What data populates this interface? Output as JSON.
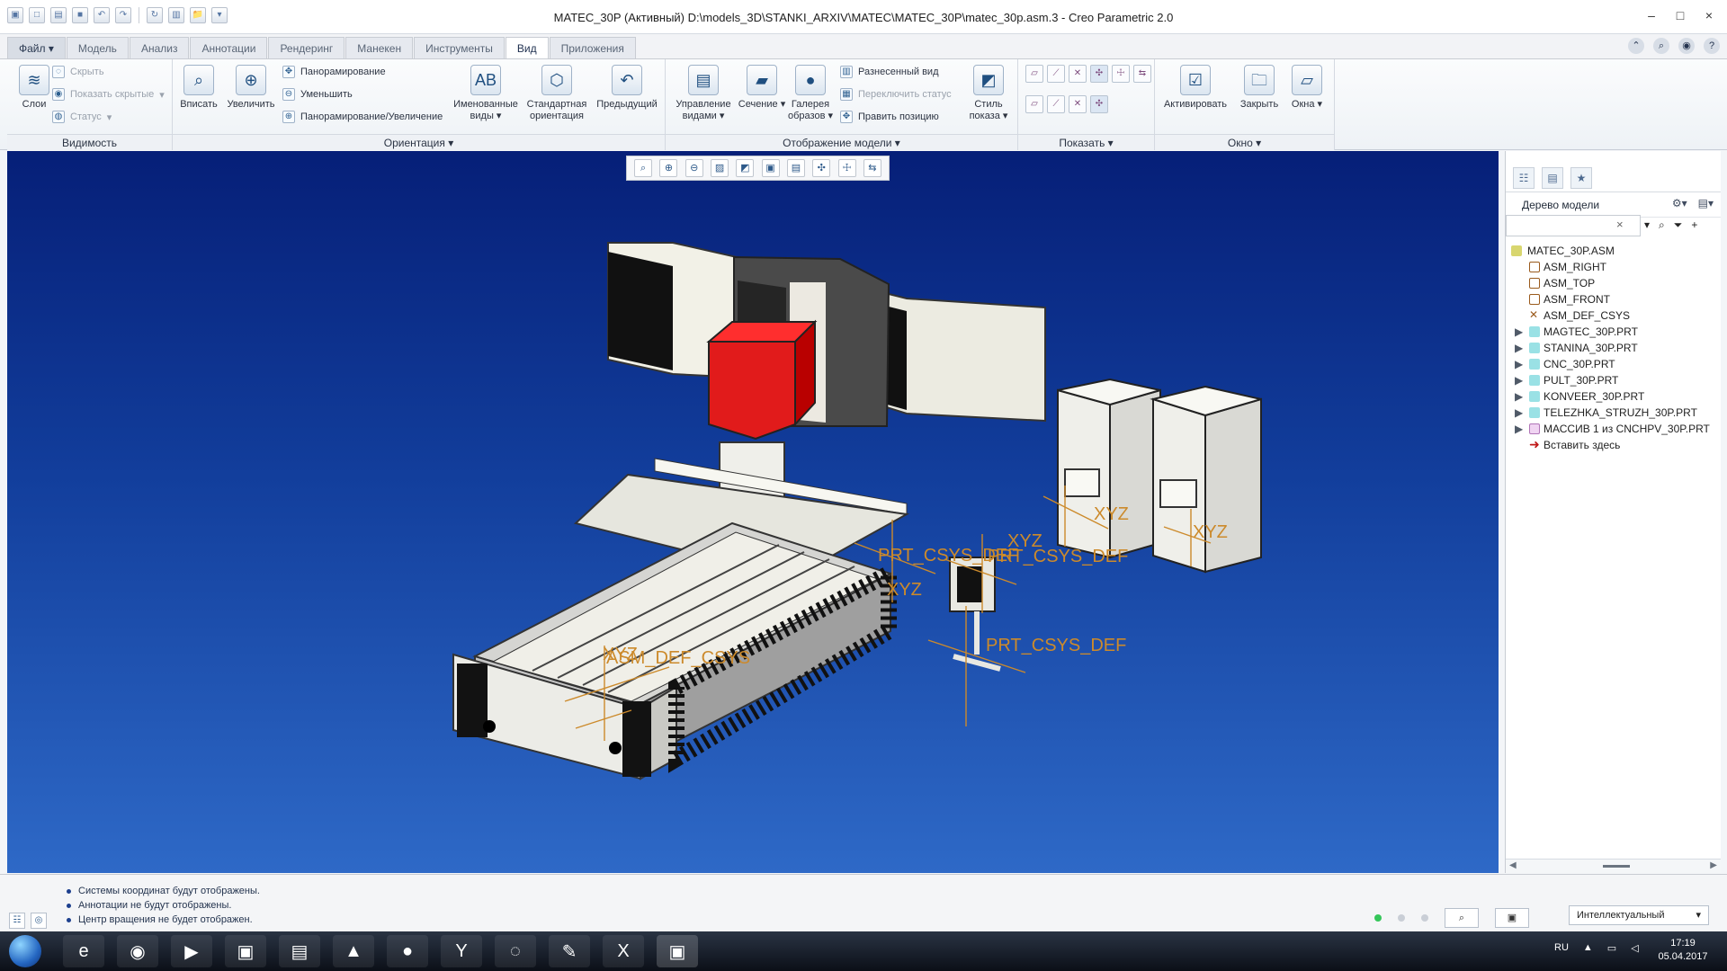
{
  "window": {
    "title": "MATEC_30P (Активный) D:\\models_3D\\STANKI_ARXIV\\MATEC\\MATEC_30P\\matec_30p.asm.3 - Creo Parametric 2.0"
  },
  "menu": {
    "tabs": [
      "Файл ▾",
      "Модель",
      "Анализ",
      "Аннотации",
      "Рендеринг",
      "Манекен",
      "Инструменты",
      "Вид",
      "Приложения"
    ]
  },
  "ribbon": {
    "visibility": {
      "label": "Видимость",
      "layers": "Слои",
      "hide": "Скрыть",
      "show_hidden": "Показать скрытые",
      "status": "Статус"
    },
    "orientation": {
      "label": "Ориентация",
      "fit": "Вписать",
      "zoom_in": "Увеличить",
      "pan": "Панорамирование",
      "zoom_out": "Уменьшить",
      "pan_zoom": "Панорамирование/Увеличение",
      "named_views": "Именованные виды",
      "standard_orientation": "Стандартная ориентация",
      "previous": "Предыдущий"
    },
    "model_display": {
      "label": "Отображение модели",
      "manage_views": "Управление видами",
      "section": "Сечение",
      "appearance_gallery": "Галерея образов",
      "exploded_view": "Разнесенный вид",
      "toggle_status": "Переключить статус",
      "edit_position": "Править позицию",
      "display_style": "Стиль показа"
    },
    "show": {
      "label": "Показать"
    },
    "window": {
      "label": "Окно",
      "activate": "Активировать",
      "close": "Закрыть",
      "windows": "Окна"
    }
  },
  "model_tree": {
    "title": "Дерево модели",
    "items": [
      "MATEC_30P.ASM",
      "ASM_RIGHT",
      "ASM_TOP",
      "ASM_FRONT",
      "ASM_DEF_CSYS",
      "MAGTEC_30P.PRT",
      "STANINA_30P.PRT",
      "CNC_30P.PRT",
      "PULT_30P.PRT",
      "KONVEER_30P.PRT",
      "TELEZHKA_STRUZH_30P.PRT",
      "МАССИВ 1 из CNCHPV_30P.PRT",
      "Вставить здесь"
    ]
  },
  "viewport": {
    "labels": [
      "PRT_CSYS_DEF",
      "PRT_CSYS_DEF",
      "PRT_CSYS_DEF",
      "ASM_DEF_CSYS",
      "XYZ",
      "XYZ",
      "XYZ",
      "XYZ",
      "XYZ"
    ]
  },
  "status": {
    "messages": [
      "Системы координат будут отображены.",
      "Аннотации не будут отображены.",
      "Центр вращения не будет отображен."
    ],
    "filter": "Интеллектуальный"
  },
  "taskbar": {
    "language": "RU",
    "time": "17:19",
    "date": "05.04.2017"
  }
}
